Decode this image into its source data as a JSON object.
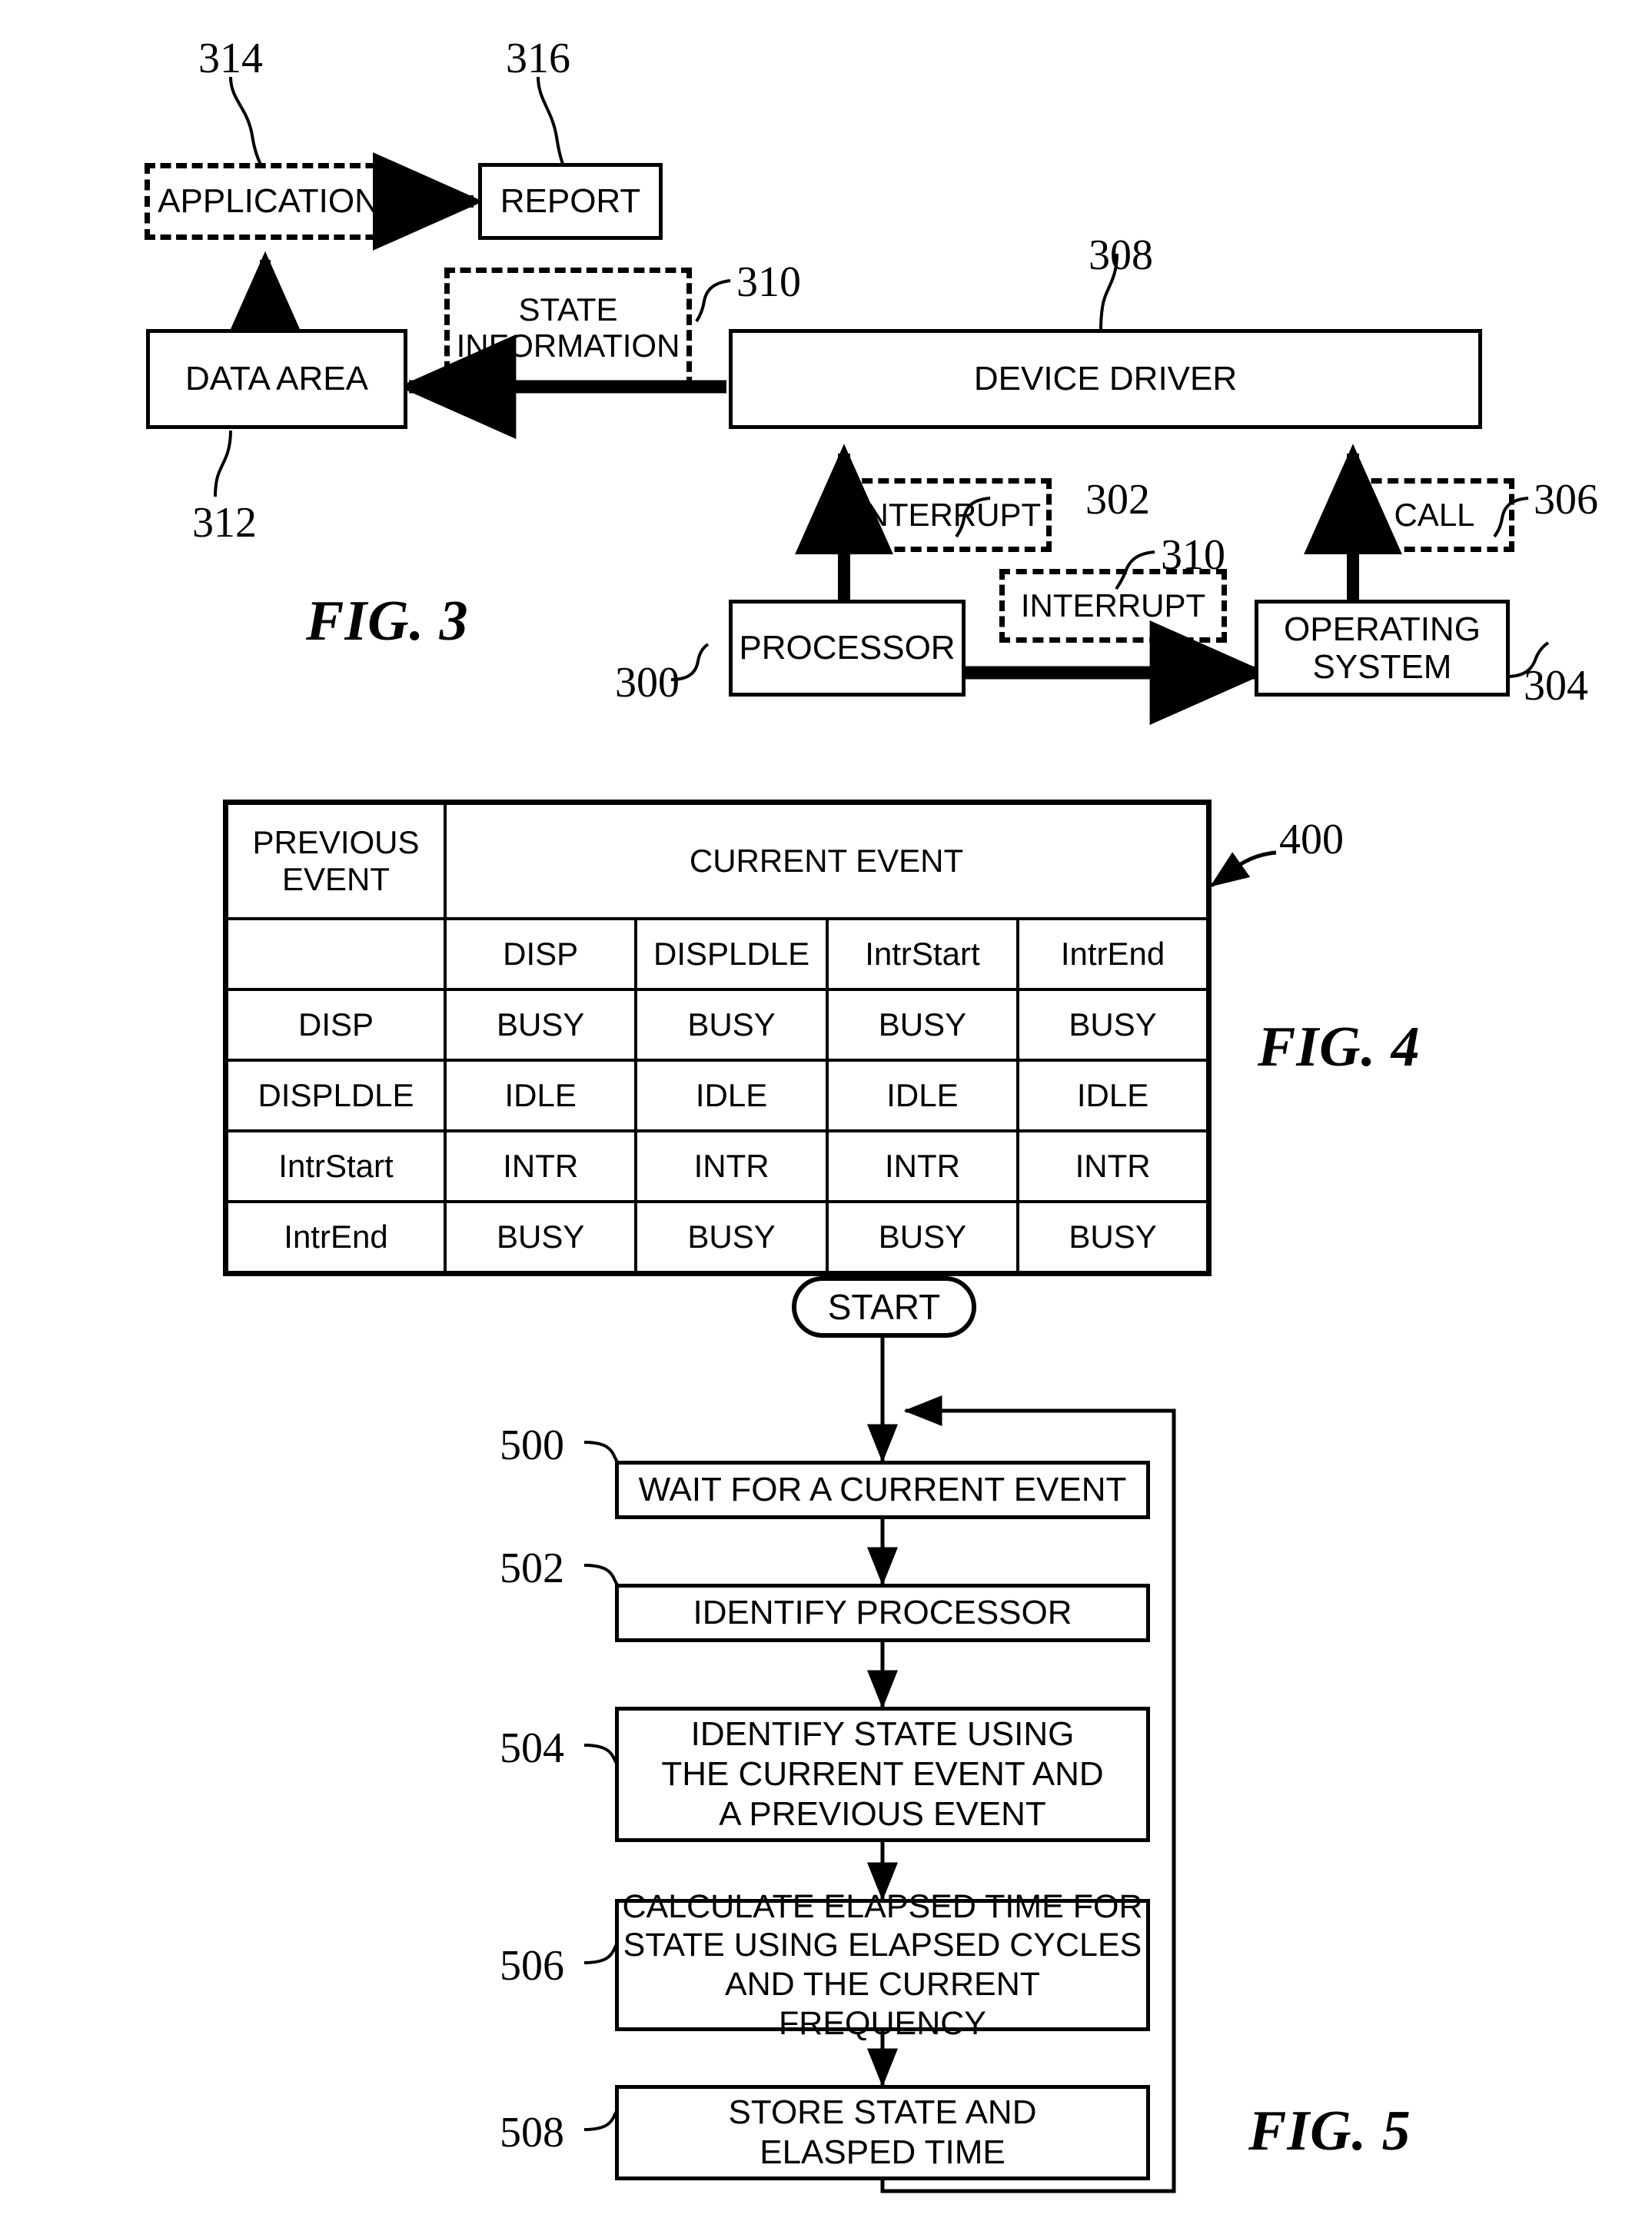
{
  "figures": {
    "fig3": {
      "caption": "FIG. 3",
      "blocks": {
        "application": "APPLICATION",
        "report": "REPORT",
        "data_area": "DATA AREA",
        "state_information": "STATE\nINFORMATION",
        "state_information_line1": "STATE",
        "state_information_line2": "INFORMATION",
        "device_driver": "DEVICE DRIVER",
        "interrupt_to_driver": "INTERRUPT",
        "interrupt_to_os": "INTERRUPT",
        "call": "CALL",
        "processor": "PROCESSOR",
        "operating_system_line1": "OPERATING",
        "operating_system_line2": "SYSTEM"
      },
      "refs": {
        "application": "314",
        "report": "316",
        "state_information": "310",
        "device_driver": "308",
        "data_area": "312",
        "interrupt_to_driver": "302",
        "call": "306",
        "interrupt_to_os": "310",
        "processor": "300",
        "operating_system": "304"
      }
    },
    "fig4": {
      "caption": "FIG. 4",
      "ref": "400",
      "corner_header": "PREVIOUS\nEVENT",
      "corner_header_line1": "PREVIOUS",
      "corner_header_line2": "EVENT",
      "span_header": "CURRENT EVENT",
      "blank_cell": "",
      "columns": [
        "DISP",
        "DISPLDLE",
        "IntrStart",
        "IntrEnd"
      ],
      "rows": [
        {
          "label": "DISP",
          "values": [
            "BUSY",
            "BUSY",
            "BUSY",
            "BUSY"
          ]
        },
        {
          "label": "DISPLDLE",
          "values": [
            "IDLE",
            "IDLE",
            "IDLE",
            "IDLE"
          ]
        },
        {
          "label": "IntrStart",
          "values": [
            "INTR",
            "INTR",
            "INTR",
            "INTR"
          ]
        },
        {
          "label": "IntrEnd",
          "values": [
            "BUSY",
            "BUSY",
            "BUSY",
            "BUSY"
          ]
        }
      ]
    },
    "fig5": {
      "caption": "FIG. 5",
      "start": "START",
      "steps": [
        {
          "ref": "500",
          "text": "WAIT FOR A CURRENT EVENT"
        },
        {
          "ref": "502",
          "text": "IDENTIFY PROCESSOR"
        },
        {
          "ref": "504",
          "text": "IDENTIFY STATE USING\nTHE CURRENT EVENT AND\nA PREVIOUS EVENT"
        },
        {
          "ref": "506",
          "text": "CALCULATE ELAPSED TIME FOR\nSTATE USING ELAPSED CYCLES\nAND THE CURRENT FREQUENCY"
        },
        {
          "ref": "508",
          "text": "STORE STATE AND\nELASPED TIME"
        }
      ],
      "step_lines": {
        "s504_l1": "IDENTIFY STATE USING",
        "s504_l2": "THE CURRENT EVENT AND",
        "s504_l3": "A PREVIOUS EVENT",
        "s506_l1": "CALCULATE ELAPSED TIME FOR",
        "s506_l2": "STATE USING ELAPSED CYCLES",
        "s506_l3": "AND THE CURRENT FREQUENCY",
        "s508_l1": "STORE STATE AND",
        "s508_l2": "ELASPED TIME"
      }
    }
  },
  "colors": {
    "ink": "#000000",
    "paper": "#ffffff"
  }
}
